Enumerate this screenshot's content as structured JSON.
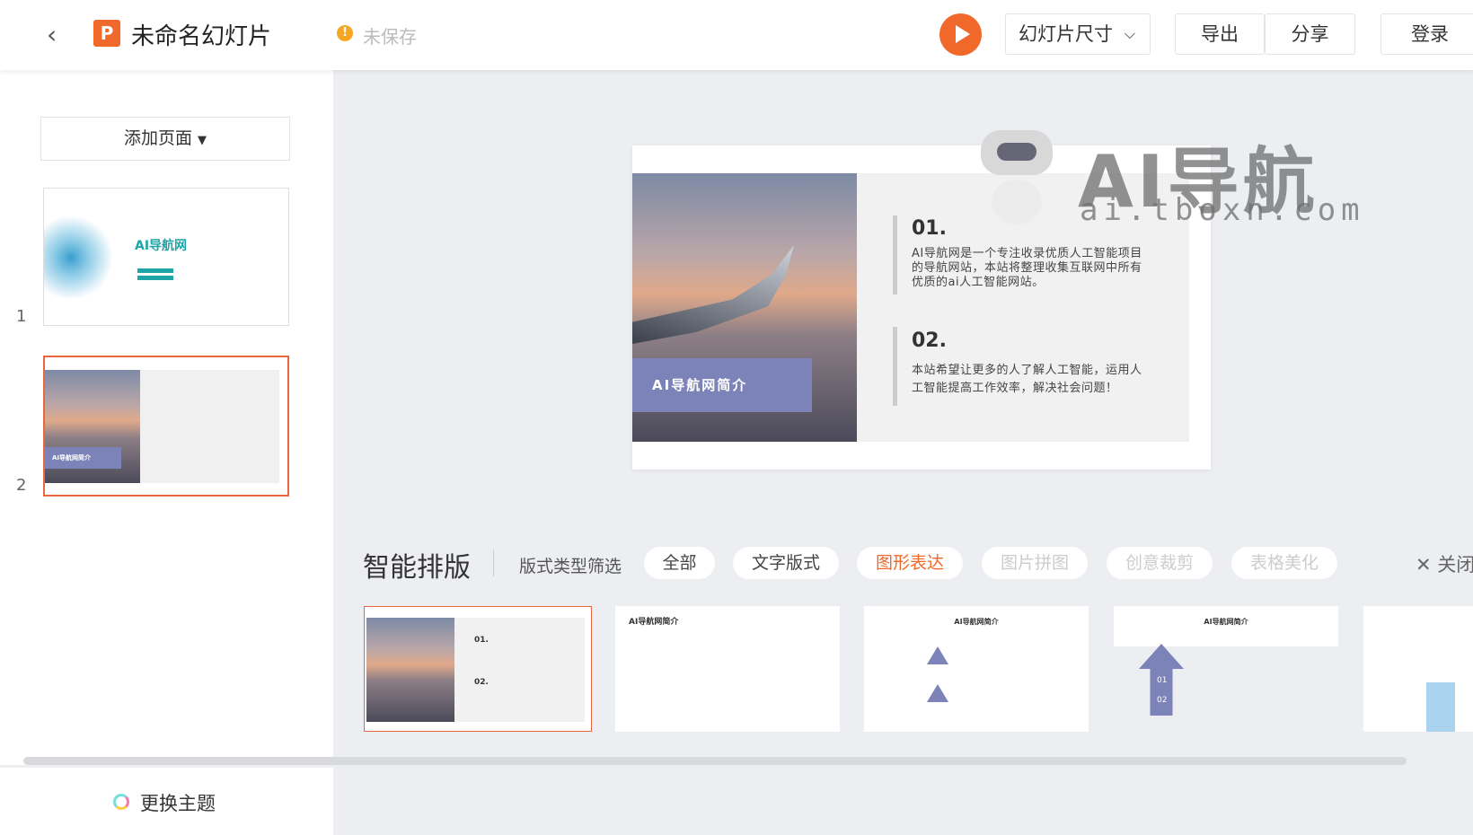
{
  "header": {
    "title": "未命名幻灯片",
    "save_status": "未保存",
    "slide_size": "幻灯片尺寸",
    "export": "导出",
    "share": "分享",
    "login": "登录"
  },
  "sidebar": {
    "add_page": "添加页面",
    "slides": [
      {
        "number": "1",
        "title": "AI导航网"
      },
      {
        "number": "2",
        "banner": "AI导航网简介"
      }
    ],
    "change_theme": "更换主题"
  },
  "slide": {
    "banner": "AI导航网简介",
    "sections": [
      {
        "num": "01.",
        "text": "AI导航网是一个专注收录优质人工智能项目的导航网站，本站将整理收集互联网中所有优质的ai人工智能网站。"
      },
      {
        "num": "02.",
        "text": "本站希望让更多的人了解人工智能，运用人工智能提高工作效率，解决社会问题！"
      }
    ]
  },
  "watermark": {
    "title": "AI导航",
    "url": "ai.tboxn.com"
  },
  "smart_layout": {
    "title": "智能排版",
    "filter_label": "版式类型筛选",
    "filters": [
      "全部",
      "文字版式",
      "图形表达",
      "图片拼图",
      "创意裁剪",
      "表格美化"
    ],
    "active_filter": "图形表达",
    "close": "关闭",
    "thumb_title": "AI导航网简介",
    "thumb_nums": [
      "01.",
      "02.",
      "01",
      "02"
    ]
  },
  "colors": {
    "accent": "#f0692b",
    "banner": "#7c83b8",
    "teal": "#1fa5a8"
  }
}
